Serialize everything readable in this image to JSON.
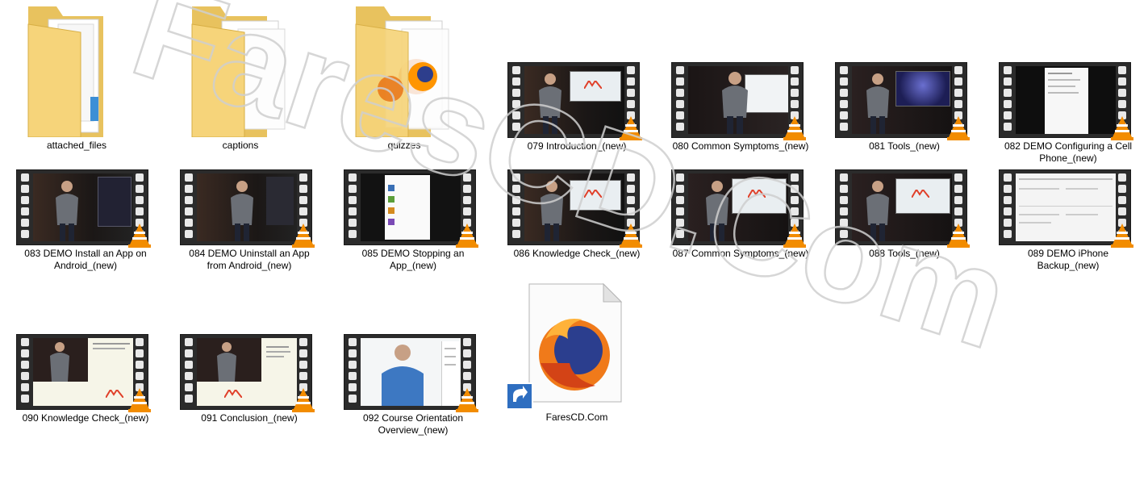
{
  "items": [
    {
      "label": "attached_files",
      "kind": "folder"
    },
    {
      "label": "captions",
      "kind": "folder"
    },
    {
      "label": "quizzes",
      "kind": "folder"
    },
    {
      "label": "079 Introduction_(new)",
      "kind": "video"
    },
    {
      "label": "080 Common Symptoms_(new)",
      "kind": "video"
    },
    {
      "label": "081 Tools_(new)",
      "kind": "video"
    },
    {
      "label": "082 DEMO Configuring a Cell Phone_(new)",
      "kind": "video"
    },
    {
      "label": "083 DEMO Install an App on Android_(new)",
      "kind": "video"
    },
    {
      "label": "084 DEMO Uninstall an App from Android_(new)",
      "kind": "video"
    },
    {
      "label": "085 DEMO Stopping an App_(new)",
      "kind": "video"
    },
    {
      "label": "086 Knowledge Check_(new)",
      "kind": "video"
    },
    {
      "label": "087 Common Symptoms_(new)",
      "kind": "video"
    },
    {
      "label": "088 Tools_(new)",
      "kind": "video"
    },
    {
      "label": "089 DEMO iPhone Backup_(new)",
      "kind": "video"
    },
    {
      "label": "090 Knowledge Check_(new)",
      "kind": "video"
    },
    {
      "label": "091 Conclusion_(new)",
      "kind": "video"
    },
    {
      "label": "092 Course Orientation Overview_(new)",
      "kind": "video"
    },
    {
      "label": "FaresCD.Com",
      "kind": "shortcut"
    }
  ],
  "watermark": {
    "text": "FaresCD.Com"
  },
  "colors": {
    "folder": "#f6d47a",
    "film": "#2b2b2b",
    "vlc": "#f28c00"
  }
}
